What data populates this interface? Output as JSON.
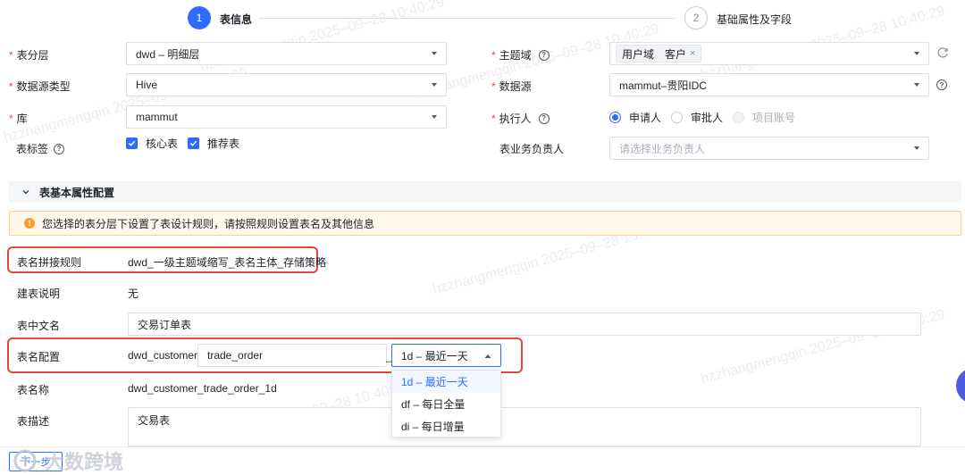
{
  "steps": [
    {
      "num": "1",
      "label": "表信息"
    },
    {
      "num": "2",
      "label": "基础属性及字段"
    }
  ],
  "form": {
    "layer": {
      "label": "表分层",
      "value": "dwd – 明细层"
    },
    "datasource_type": {
      "label": "数据源类型",
      "value": "Hive"
    },
    "db": {
      "label": "库",
      "value": "mammut"
    },
    "table_tags": {
      "label": "表标签",
      "options": [
        "核心表",
        "推荐表"
      ]
    },
    "subject": {
      "label": "主题域",
      "tags": [
        "用户域",
        "客户"
      ]
    },
    "datasource": {
      "label": "数据源",
      "value": "mammut–贵阳IDC"
    },
    "executor": {
      "label": "执行人",
      "options": [
        "申请人",
        "审批人",
        "项目账号"
      ]
    },
    "owner": {
      "label": "表业务负责人",
      "placeholder": "请选择业务负责人"
    }
  },
  "section": {
    "title": "表基本属性配置",
    "alert": "您选择的表分层下设置了表设计规则，请按照规则设置表名及其他信息",
    "name_rule_label": "表名拼接规则",
    "name_rule_value": "dwd_一级主题域缩写_表名主体_存储策略",
    "desc_label": "建表说明",
    "desc_value": "无",
    "cn_name_label": "表中文名",
    "cn_name_value": "交易订单表",
    "config_label": "表名配置",
    "config_prefix": "dwd_customer_",
    "config_body": "trade_order",
    "config_sep": "_",
    "config_strategy": "1d – 最近一天",
    "strategy_options": [
      "1d – 最近一天",
      "df – 每日全量",
      "di – 每日增量"
    ],
    "tname_label": "表名称",
    "tname_value": "dwd_customer_trade_order_1d",
    "tdesc_label": "表描述",
    "tdesc_value": "交易表"
  },
  "footer": {
    "next": "下一步",
    "brand": "大数跨境"
  },
  "watermark": "hzzhangmengqin 2025–09–28 10:40:29",
  "colors": {
    "primary": "#2f6bff",
    "danger": "#f53f3f",
    "highlight": "#e8453c",
    "warning_bg": "#fff7e8"
  }
}
